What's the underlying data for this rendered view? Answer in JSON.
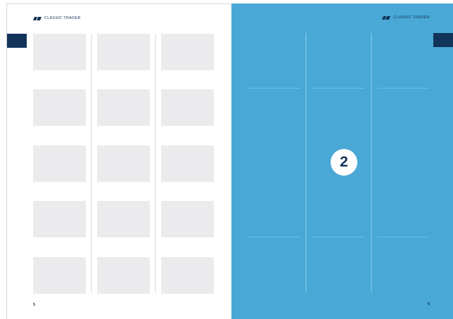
{
  "brand": {
    "name": "CLASSIC TRADER",
    "logo_icon": "classic-trader-logo-icon"
  },
  "left_page": {
    "folio": "5"
  },
  "right_page": {
    "folio": "5",
    "badge": "2"
  },
  "colors": {
    "navy": "#12345a",
    "blue": "#49a8d6",
    "placeholder": "#ebebed"
  }
}
